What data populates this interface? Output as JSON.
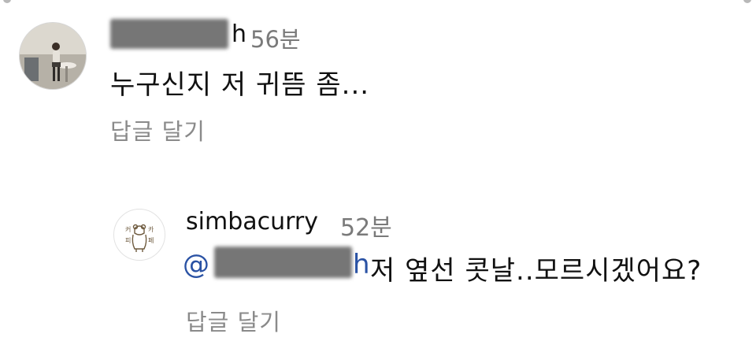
{
  "comment": {
    "username_suffix": "h",
    "time": "56분",
    "text": "누구신지 저 귀뜸 좀...",
    "reply_label": "답글 달기"
  },
  "reply": {
    "username": "simbacurry",
    "time": "52분",
    "mention_prefix": "@",
    "mention_suffix": "h",
    "text": "저 옆선 콧날..모르시겠어요?",
    "reply_label": "답글 달기",
    "avatar_logo_text": "커피 카페"
  }
}
